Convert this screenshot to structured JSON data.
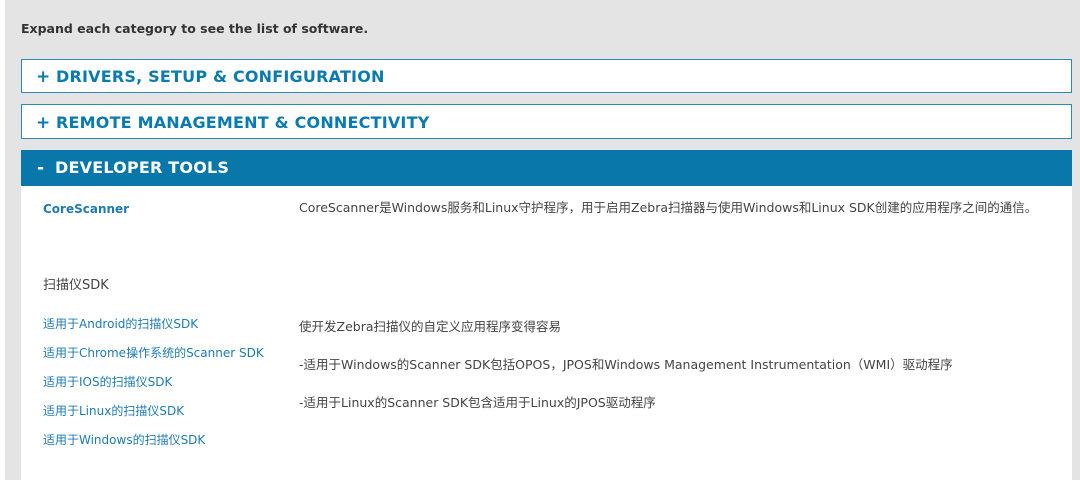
{
  "intro": "Expand each category to see the list of software.",
  "accordions": [
    {
      "sign": "+",
      "title": "DRIVERS, SETUP & CONFIGURATION"
    },
    {
      "sign": "+",
      "title": "REMOTE MANAGEMENT & CONNECTIVITY"
    },
    {
      "sign": "-",
      "title": "DEVELOPER TOOLS"
    }
  ],
  "developer_tools": {
    "corescanner": {
      "label": "CoreScanner",
      "description": "CoreScanner是Windows服务和Linux守护程序，用于启用Zebra扫描器与使用Windows和Linux SDK创建的应用程序之间的通信。"
    },
    "sdk_section": {
      "heading": "扫描仪SDK",
      "links": [
        "适用于Android的扫描仪SDK",
        "适用于Chrome操作系统的Scanner SDK",
        "适用于IOS的扫描仪SDK",
        "适用于Linux的扫描仪SDK",
        "适用于Windows的扫描仪SDK"
      ],
      "descriptions": [
        "使开发Zebra扫描仪的自定义应用程序变得容易",
        "-适用于Windows的Scanner SDK包括OPOS，JPOS和Windows Management Instrumentation（WMI）驱动程序",
        "-适用于Linux的Scanner SDK包含适用于Linux的JPOS驱动程序"
      ]
    }
  },
  "colors": {
    "accent": "#0a77ab",
    "link": "#1d7bb5",
    "panel_bg": "#e4e4e4"
  }
}
